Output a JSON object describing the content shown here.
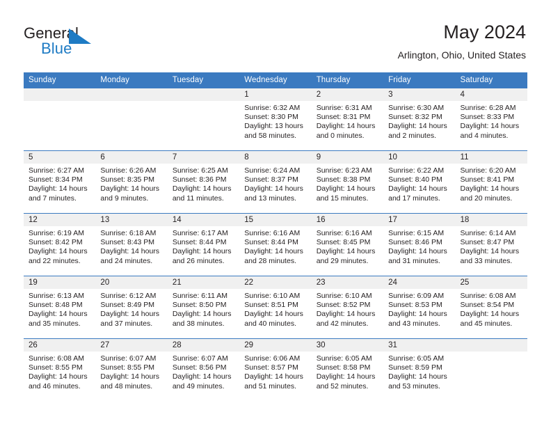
{
  "brand": {
    "name_part1": "General",
    "name_part2": "Blue",
    "mark_color": "#1e7bc4"
  },
  "header": {
    "title": "May 2024",
    "location": "Arlington, Ohio, United States"
  },
  "theme": {
    "header_blue": "#3b7ac0",
    "day_band_gray": "#f0f0f0",
    "text": "#231f20"
  },
  "weekdays": [
    "Sunday",
    "Monday",
    "Tuesday",
    "Wednesday",
    "Thursday",
    "Friday",
    "Saturday"
  ],
  "weeks": [
    [
      {
        "day": "",
        "sunrise": "",
        "sunset": "",
        "daylight_1": "",
        "daylight_2": ""
      },
      {
        "day": "",
        "sunrise": "",
        "sunset": "",
        "daylight_1": "",
        "daylight_2": ""
      },
      {
        "day": "",
        "sunrise": "",
        "sunset": "",
        "daylight_1": "",
        "daylight_2": ""
      },
      {
        "day": "1",
        "sunrise": "Sunrise: 6:32 AM",
        "sunset": "Sunset: 8:30 PM",
        "daylight_1": "Daylight: 13 hours",
        "daylight_2": "and 58 minutes."
      },
      {
        "day": "2",
        "sunrise": "Sunrise: 6:31 AM",
        "sunset": "Sunset: 8:31 PM",
        "daylight_1": "Daylight: 14 hours",
        "daylight_2": "and 0 minutes."
      },
      {
        "day": "3",
        "sunrise": "Sunrise: 6:30 AM",
        "sunset": "Sunset: 8:32 PM",
        "daylight_1": "Daylight: 14 hours",
        "daylight_2": "and 2 minutes."
      },
      {
        "day": "4",
        "sunrise": "Sunrise: 6:28 AM",
        "sunset": "Sunset: 8:33 PM",
        "daylight_1": "Daylight: 14 hours",
        "daylight_2": "and 4 minutes."
      }
    ],
    [
      {
        "day": "5",
        "sunrise": "Sunrise: 6:27 AM",
        "sunset": "Sunset: 8:34 PM",
        "daylight_1": "Daylight: 14 hours",
        "daylight_2": "and 7 minutes."
      },
      {
        "day": "6",
        "sunrise": "Sunrise: 6:26 AM",
        "sunset": "Sunset: 8:35 PM",
        "daylight_1": "Daylight: 14 hours",
        "daylight_2": "and 9 minutes."
      },
      {
        "day": "7",
        "sunrise": "Sunrise: 6:25 AM",
        "sunset": "Sunset: 8:36 PM",
        "daylight_1": "Daylight: 14 hours",
        "daylight_2": "and 11 minutes."
      },
      {
        "day": "8",
        "sunrise": "Sunrise: 6:24 AM",
        "sunset": "Sunset: 8:37 PM",
        "daylight_1": "Daylight: 14 hours",
        "daylight_2": "and 13 minutes."
      },
      {
        "day": "9",
        "sunrise": "Sunrise: 6:23 AM",
        "sunset": "Sunset: 8:38 PM",
        "daylight_1": "Daylight: 14 hours",
        "daylight_2": "and 15 minutes."
      },
      {
        "day": "10",
        "sunrise": "Sunrise: 6:22 AM",
        "sunset": "Sunset: 8:40 PM",
        "daylight_1": "Daylight: 14 hours",
        "daylight_2": "and 17 minutes."
      },
      {
        "day": "11",
        "sunrise": "Sunrise: 6:20 AM",
        "sunset": "Sunset: 8:41 PM",
        "daylight_1": "Daylight: 14 hours",
        "daylight_2": "and 20 minutes."
      }
    ],
    [
      {
        "day": "12",
        "sunrise": "Sunrise: 6:19 AM",
        "sunset": "Sunset: 8:42 PM",
        "daylight_1": "Daylight: 14 hours",
        "daylight_2": "and 22 minutes."
      },
      {
        "day": "13",
        "sunrise": "Sunrise: 6:18 AM",
        "sunset": "Sunset: 8:43 PM",
        "daylight_1": "Daylight: 14 hours",
        "daylight_2": "and 24 minutes."
      },
      {
        "day": "14",
        "sunrise": "Sunrise: 6:17 AM",
        "sunset": "Sunset: 8:44 PM",
        "daylight_1": "Daylight: 14 hours",
        "daylight_2": "and 26 minutes."
      },
      {
        "day": "15",
        "sunrise": "Sunrise: 6:16 AM",
        "sunset": "Sunset: 8:44 PM",
        "daylight_1": "Daylight: 14 hours",
        "daylight_2": "and 28 minutes."
      },
      {
        "day": "16",
        "sunrise": "Sunrise: 6:16 AM",
        "sunset": "Sunset: 8:45 PM",
        "daylight_1": "Daylight: 14 hours",
        "daylight_2": "and 29 minutes."
      },
      {
        "day": "17",
        "sunrise": "Sunrise: 6:15 AM",
        "sunset": "Sunset: 8:46 PM",
        "daylight_1": "Daylight: 14 hours",
        "daylight_2": "and 31 minutes."
      },
      {
        "day": "18",
        "sunrise": "Sunrise: 6:14 AM",
        "sunset": "Sunset: 8:47 PM",
        "daylight_1": "Daylight: 14 hours",
        "daylight_2": "and 33 minutes."
      }
    ],
    [
      {
        "day": "19",
        "sunrise": "Sunrise: 6:13 AM",
        "sunset": "Sunset: 8:48 PM",
        "daylight_1": "Daylight: 14 hours",
        "daylight_2": "and 35 minutes."
      },
      {
        "day": "20",
        "sunrise": "Sunrise: 6:12 AM",
        "sunset": "Sunset: 8:49 PM",
        "daylight_1": "Daylight: 14 hours",
        "daylight_2": "and 37 minutes."
      },
      {
        "day": "21",
        "sunrise": "Sunrise: 6:11 AM",
        "sunset": "Sunset: 8:50 PM",
        "daylight_1": "Daylight: 14 hours",
        "daylight_2": "and 38 minutes."
      },
      {
        "day": "22",
        "sunrise": "Sunrise: 6:10 AM",
        "sunset": "Sunset: 8:51 PM",
        "daylight_1": "Daylight: 14 hours",
        "daylight_2": "and 40 minutes."
      },
      {
        "day": "23",
        "sunrise": "Sunrise: 6:10 AM",
        "sunset": "Sunset: 8:52 PM",
        "daylight_1": "Daylight: 14 hours",
        "daylight_2": "and 42 minutes."
      },
      {
        "day": "24",
        "sunrise": "Sunrise: 6:09 AM",
        "sunset": "Sunset: 8:53 PM",
        "daylight_1": "Daylight: 14 hours",
        "daylight_2": "and 43 minutes."
      },
      {
        "day": "25",
        "sunrise": "Sunrise: 6:08 AM",
        "sunset": "Sunset: 8:54 PM",
        "daylight_1": "Daylight: 14 hours",
        "daylight_2": "and 45 minutes."
      }
    ],
    [
      {
        "day": "26",
        "sunrise": "Sunrise: 6:08 AM",
        "sunset": "Sunset: 8:55 PM",
        "daylight_1": "Daylight: 14 hours",
        "daylight_2": "and 46 minutes."
      },
      {
        "day": "27",
        "sunrise": "Sunrise: 6:07 AM",
        "sunset": "Sunset: 8:55 PM",
        "daylight_1": "Daylight: 14 hours",
        "daylight_2": "and 48 minutes."
      },
      {
        "day": "28",
        "sunrise": "Sunrise: 6:07 AM",
        "sunset": "Sunset: 8:56 PM",
        "daylight_1": "Daylight: 14 hours",
        "daylight_2": "and 49 minutes."
      },
      {
        "day": "29",
        "sunrise": "Sunrise: 6:06 AM",
        "sunset": "Sunset: 8:57 PM",
        "daylight_1": "Daylight: 14 hours",
        "daylight_2": "and 51 minutes."
      },
      {
        "day": "30",
        "sunrise": "Sunrise: 6:05 AM",
        "sunset": "Sunset: 8:58 PM",
        "daylight_1": "Daylight: 14 hours",
        "daylight_2": "and 52 minutes."
      },
      {
        "day": "31",
        "sunrise": "Sunrise: 6:05 AM",
        "sunset": "Sunset: 8:59 PM",
        "daylight_1": "Daylight: 14 hours",
        "daylight_2": "and 53 minutes."
      },
      {
        "day": "",
        "sunrise": "",
        "sunset": "",
        "daylight_1": "",
        "daylight_2": ""
      }
    ]
  ]
}
